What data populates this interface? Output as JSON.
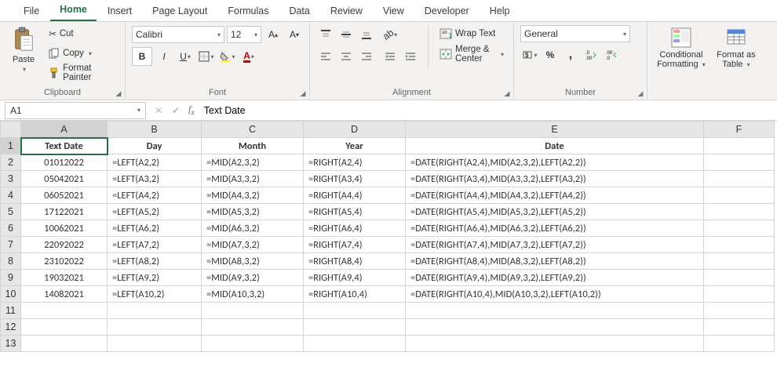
{
  "tabs": [
    "File",
    "Home",
    "Insert",
    "Page Layout",
    "Formulas",
    "Data",
    "Review",
    "View",
    "Developer",
    "Help"
  ],
  "active_tab_index": 1,
  "clipboard": {
    "paste": "Paste",
    "cut": "Cut",
    "copy": "Copy",
    "format_painter": "Format Painter",
    "group": "Clipboard"
  },
  "font": {
    "name": "Calibri",
    "size": "12",
    "group": "Font"
  },
  "alignment": {
    "wrap": "Wrap Text",
    "merge": "Merge & Center",
    "group": "Alignment"
  },
  "number": {
    "format": "General",
    "group": "Number"
  },
  "styles": {
    "cond": "Conditional Formatting",
    "table": "Format as Table"
  },
  "namebox": "A1",
  "formula": "Text Date",
  "columns": [
    "A",
    "B",
    "C",
    "D",
    "E",
    "F"
  ],
  "headers": {
    "A": "Text Date",
    "B": "Day",
    "C": "Month",
    "D": "Year",
    "E": "Date"
  },
  "rows": [
    {
      "A": "01012022",
      "B": "=LEFT(A2,2)",
      "C": "=MID(A2,3,2)",
      "D": "=RIGHT(A2,4)",
      "E": "=DATE(RIGHT(A2,4),MID(A2,3,2),LEFT(A2,2))"
    },
    {
      "A": "05042021",
      "B": "=LEFT(A3,2)",
      "C": "=MID(A3,3,2)",
      "D": "=RIGHT(A3,4)",
      "E": "=DATE(RIGHT(A3,4),MID(A3,3,2),LEFT(A3,2))"
    },
    {
      "A": "06052021",
      "B": "=LEFT(A4,2)",
      "C": "=MID(A4,3,2)",
      "D": "=RIGHT(A4,4)",
      "E": "=DATE(RIGHT(A4,4),MID(A4,3,2),LEFT(A4,2))"
    },
    {
      "A": "17122021",
      "B": "=LEFT(A5,2)",
      "C": "=MID(A5,3,2)",
      "D": "=RIGHT(A5,4)",
      "E": "=DATE(RIGHT(A5,4),MID(A5,3,2),LEFT(A5,2))"
    },
    {
      "A": "10062021",
      "B": "=LEFT(A6,2)",
      "C": "=MID(A6,3,2)",
      "D": "=RIGHT(A6,4)",
      "E": "=DATE(RIGHT(A6,4),MID(A6,3,2),LEFT(A6,2))"
    },
    {
      "A": "22092022",
      "B": "=LEFT(A7,2)",
      "C": "=MID(A7,3,2)",
      "D": "=RIGHT(A7,4)",
      "E": "=DATE(RIGHT(A7,4),MID(A7,3,2),LEFT(A7,2))"
    },
    {
      "A": "23102022",
      "B": "=LEFT(A8,2)",
      "C": "=MID(A8,3,2)",
      "D": "=RIGHT(A8,4)",
      "E": "=DATE(RIGHT(A8,4),MID(A8,3,2),LEFT(A8,2))"
    },
    {
      "A": "19032021",
      "B": "=LEFT(A9,2)",
      "C": "=MID(A9,3,2)",
      "D": "=RIGHT(A9,4)",
      "E": "=DATE(RIGHT(A9,4),MID(A9,3,2),LEFT(A9,2))"
    },
    {
      "A": "14082021",
      "B": "=LEFT(A10,2)",
      "C": "=MID(A10,3,2)",
      "D": "=RIGHT(A10,4)",
      "E": "=DATE(RIGHT(A10,4),MID(A10,3,2),LEFT(A10,2))"
    }
  ],
  "empty_rows": [
    11,
    12,
    13
  ]
}
